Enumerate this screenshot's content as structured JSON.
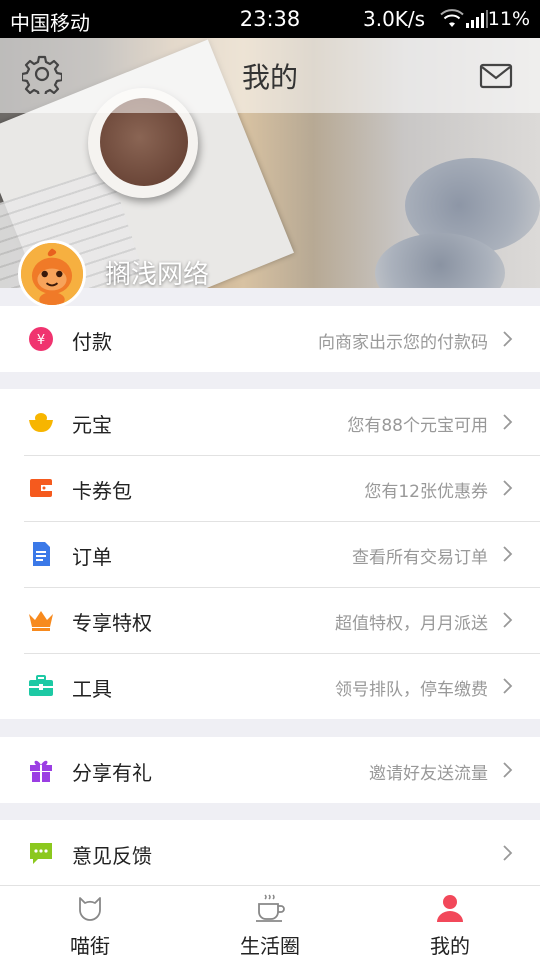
{
  "status_bar": {
    "carrier": "中国移动",
    "time": "23:38",
    "network_speed": "3.0K/s",
    "battery": "11%"
  },
  "header": {
    "title": "我的",
    "username": "搁浅网络",
    "settings_icon": "gear-icon",
    "message_icon": "mail-icon"
  },
  "groups": [
    {
      "items": [
        {
          "label": "付款",
          "hint": "向商家出示您的付款码",
          "icon": "payment-icon",
          "color": "#f0336f"
        }
      ]
    },
    {
      "items": [
        {
          "label": "元宝",
          "hint": "您有88个元宝可用",
          "icon": "ingot-icon",
          "color": "#f7b500"
        },
        {
          "label": "卡券包",
          "hint": "您有12张优惠券",
          "icon": "wallet-icon",
          "color": "#f55a1e"
        },
        {
          "label": "订单",
          "hint": "查看所有交易订单",
          "icon": "document-icon",
          "color": "#3b79e8"
        },
        {
          "label": "专享特权",
          "hint": "超值特权，月月派送",
          "icon": "crown-icon",
          "color": "#f78a1e"
        },
        {
          "label": "工具",
          "hint": "领号排队，停车缴费",
          "icon": "toolbox-icon",
          "color": "#1dc9a4"
        }
      ]
    },
    {
      "items": [
        {
          "label": "分享有礼",
          "hint": "邀请好友送流量",
          "icon": "gift-icon",
          "color": "#9b3ee3"
        }
      ]
    },
    {
      "items": [
        {
          "label": "意见反馈",
          "hint": "",
          "icon": "feedback-icon",
          "color": "#8bc81e"
        }
      ]
    }
  ],
  "tabbar": {
    "tabs": [
      {
        "label": "喵街",
        "icon": "cat-icon"
      },
      {
        "label": "生活圈",
        "icon": "coffee-icon"
      },
      {
        "label": "我的",
        "icon": "person-icon",
        "active_color": "#f2485a"
      }
    ]
  }
}
